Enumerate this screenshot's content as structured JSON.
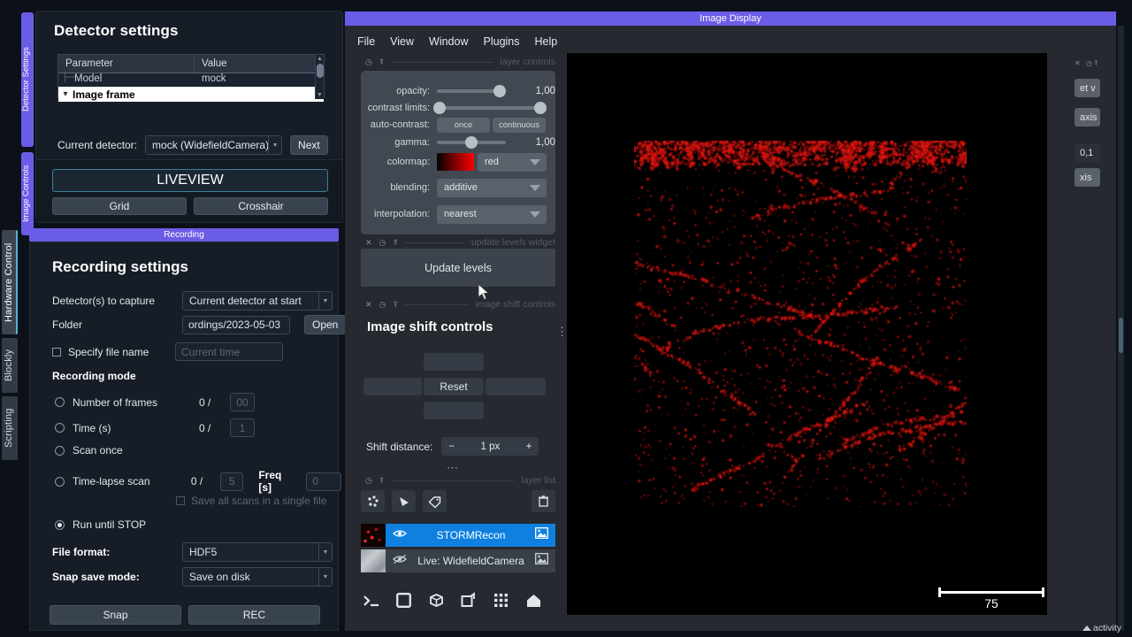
{
  "left_rail": {
    "tabs": [
      {
        "label": "Hardware Control",
        "active": true
      },
      {
        "label": "Blockly",
        "active": false
      },
      {
        "label": "Scripting",
        "active": false
      }
    ]
  },
  "dock_tabs": [
    {
      "label": "Detector Settings"
    },
    {
      "label": "Image Controls"
    }
  ],
  "detector_panel": {
    "title": "Detector settings",
    "table": {
      "columns": [
        "Parameter",
        "Value"
      ],
      "rows": [
        {
          "parameter": "Model",
          "value": "mock"
        }
      ],
      "selected_row": "Image frame"
    },
    "current_detector_label": "Current detector:",
    "current_detector_value": "mock (WidefieldCamera)",
    "next_button": "Next"
  },
  "image_controls": {
    "liveview_button": "LIVEVIEW",
    "grid_button": "Grid",
    "crosshair_button": "Crosshair"
  },
  "recording": {
    "titlebar": "Recording",
    "heading": "Recording settings",
    "detectors_label": "Detector(s) to capture",
    "detectors_value": "Current detector at start",
    "folder_label": "Folder",
    "folder_value": "ordings/2023-05-03",
    "open_button": "Open",
    "specify_file_name_label": "Specify file name",
    "specify_file_name_checked": false,
    "file_name_placeholder": "Current time",
    "mode_heading": "Recording mode",
    "modes": [
      {
        "label": "Number of frames",
        "selected": false,
        "progress": "0 /",
        "value": "00"
      },
      {
        "label": "Time (s)",
        "selected": false,
        "progress": "0 /",
        "value": "1"
      },
      {
        "label": "Scan once",
        "selected": false,
        "progress": "",
        "value": ""
      },
      {
        "label": "Time-lapse scan",
        "selected": false,
        "progress": "0 /",
        "value": "5",
        "freq_label": "Freq [s]",
        "freq_value": "0"
      },
      {
        "label": "Run until STOP",
        "selected": true,
        "progress": "",
        "value": ""
      }
    ],
    "save_all_scans_label": "Save all scans in a single file",
    "save_all_scans_checked": false,
    "file_format_label": "File format:",
    "file_format_value": "HDF5",
    "snap_save_mode_label": "Snap save mode:",
    "snap_save_mode_value": "Save on disk",
    "snap_button": "Snap",
    "rec_button": "REC"
  },
  "napari": {
    "window_title": "Image Display",
    "menu": [
      "File",
      "View",
      "Window",
      "Plugins",
      "Help"
    ],
    "dock_layer_controls_title": "layer controls",
    "dock_update_levels_title": "update levels widget",
    "dock_image_shift_title": "image shift controls",
    "dock_layer_list_title": "layer list",
    "layer_controls": {
      "opacity_label": "opacity:",
      "opacity_value": "1,00",
      "contrast_limits_label": "contrast limits:",
      "auto_contrast_label": "auto-contrast:",
      "auto_contrast_once": "once",
      "auto_contrast_continuous": "continuous",
      "gamma_label": "gamma:",
      "gamma_value": "1,00",
      "colormap_label": "colormap:",
      "colormap_value": "red",
      "colormap_color": "#ff0000",
      "blending_label": "blending:",
      "blending_value": "additive",
      "interpolation_label": "interpolation:",
      "interpolation_value": "nearest"
    },
    "update_levels_button": "Update levels",
    "image_shift": {
      "heading": "Image shift controls",
      "reset_button": "Reset",
      "shift_distance_label": "Shift distance:",
      "shift_distance_value": "1 px",
      "minus": "−",
      "plus": "+"
    },
    "layer_list": {
      "layers": [
        {
          "name": "STORMRecon",
          "visible": true,
          "selected": true
        },
        {
          "name": "Live: WidefieldCamera",
          "visible": false,
          "selected": false
        }
      ]
    },
    "scalebar_value": "75"
  },
  "right_panel": {
    "chips": [
      "et v",
      "axis",
      "0,1",
      "xis"
    ]
  },
  "status": {
    "activity_label": "activity"
  },
  "icons": {
    "eye": "eye-icon",
    "eye_off": "eye-off-icon",
    "image": "image-icon",
    "trash": "trash-icon",
    "points": "points-icon",
    "shapes": "shapes-icon",
    "labels": "labels-icon",
    "console": "console-icon",
    "ndisplay2d": "2d-display-icon",
    "ndisplay3d": "3d-display-icon",
    "roll": "roll-dims-icon",
    "grid": "grid-view-icon",
    "home": "home-icon"
  }
}
